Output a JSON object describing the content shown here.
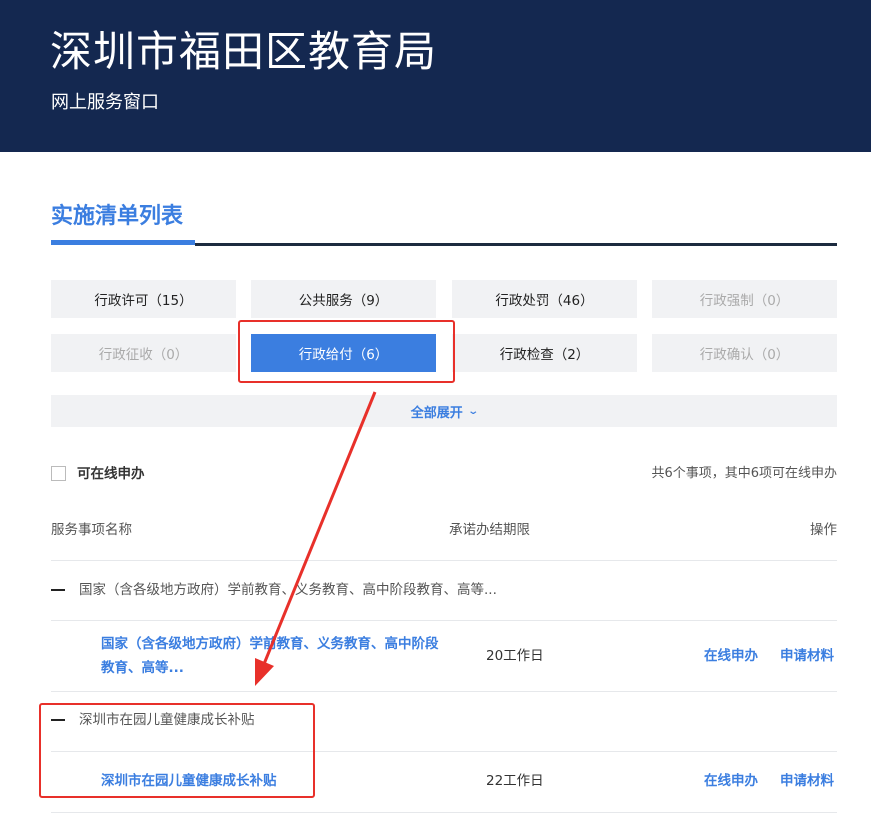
{
  "header": {
    "title": "深圳市福田区教育局",
    "subtitle": "网上服务窗口"
  },
  "section": {
    "title": "实施清单列表"
  },
  "categories": [
    {
      "label": "行政许可（15）",
      "state": "normal"
    },
    {
      "label": "公共服务（9）",
      "state": "normal"
    },
    {
      "label": "行政处罚（46）",
      "state": "normal"
    },
    {
      "label": "行政强制（0）",
      "state": "disabled"
    },
    {
      "label": "行政征收（0）",
      "state": "disabled"
    },
    {
      "label": "行政给付（6）",
      "state": "active"
    },
    {
      "label": "行政检查（2）",
      "state": "normal"
    },
    {
      "label": "行政确认（0）",
      "state": "disabled"
    }
  ],
  "expand_all": {
    "label": "全部展开",
    "icon": "chevron-down-icon"
  },
  "filter": {
    "online_only_label": "可在线申办",
    "checked": false
  },
  "summary": "共6个事项，其中6项可在线申办",
  "table": {
    "headers": {
      "name": "服务事项名称",
      "deadline": "承诺办结期限",
      "action": "操作"
    },
    "groups": [
      {
        "title": "国家（含各级地方政府）学前教育、义务教育、高中阶段教育、高等...",
        "items": [
          {
            "name_line1": "国家（含各级地方政府）学前教育、义务教育、高中阶段",
            "name_line2": "教育、高等...",
            "deadline": "20工作日",
            "action_online": "在线申办",
            "action_materials": "申请材料"
          }
        ]
      },
      {
        "title": "深圳市在园儿童健康成长补贴",
        "items": [
          {
            "name_line1": "深圳市在园儿童健康成长补贴",
            "deadline": "22工作日",
            "action_online": "在线申办",
            "action_materials": "申请材料"
          }
        ]
      }
    ]
  },
  "colors": {
    "header_bg": "#142850",
    "accent": "#3b7ee0",
    "annotation": "#e8302a"
  }
}
